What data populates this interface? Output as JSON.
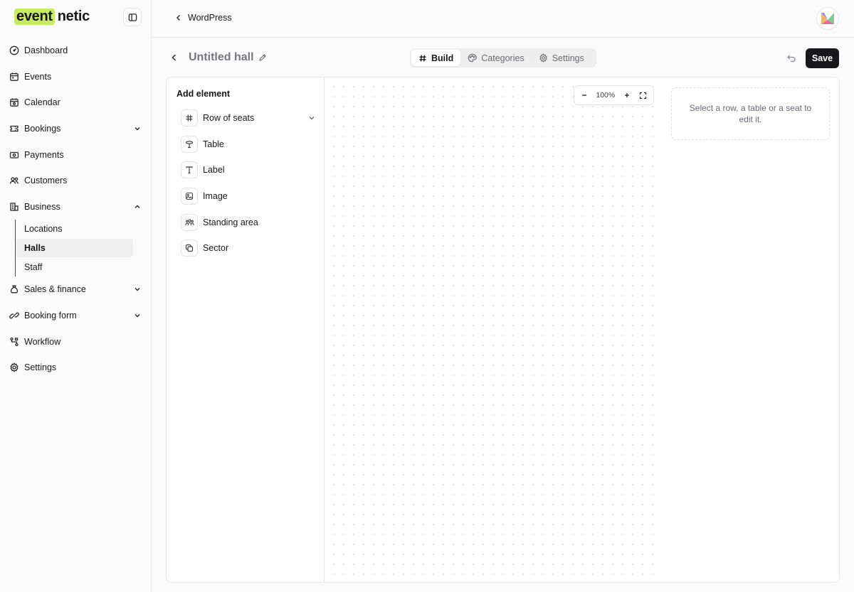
{
  "sidebar": {
    "logo": {
      "highlight": "event",
      "rest": "netic",
      "accent_color": "#c6ea60"
    },
    "collapse_icon": "sidebar-toggle-icon",
    "items": [
      {
        "label": "Dashboard",
        "icon": "gauge-icon"
      },
      {
        "label": "Events",
        "icon": "calendar-event-icon"
      },
      {
        "label": "Calendar",
        "icon": "calendar-icon"
      },
      {
        "label": "Bookings",
        "icon": "ticket-icon",
        "expandable": true,
        "expanded": false
      },
      {
        "label": "Payments",
        "icon": "cash-icon"
      },
      {
        "label": "Customers",
        "icon": "users-icon"
      },
      {
        "label": "Business",
        "icon": "building-icon",
        "expandable": true,
        "expanded": true,
        "children": [
          {
            "label": "Locations"
          },
          {
            "label": "Halls",
            "active": true
          },
          {
            "label": "Staff"
          }
        ]
      },
      {
        "label": "Sales & finance",
        "icon": "money-bag-icon",
        "expandable": true,
        "expanded": false
      },
      {
        "label": "Booking form",
        "icon": "form-icon",
        "expandable": true,
        "expanded": false
      },
      {
        "label": "Workflow",
        "icon": "workflow-icon"
      },
      {
        "label": "Settings",
        "icon": "gear-icon"
      }
    ]
  },
  "topbar": {
    "back_label": "WordPress"
  },
  "editor_header": {
    "title": "Untitled hall",
    "tabs": [
      {
        "label": "Build",
        "icon": "hash-icon",
        "active": true
      },
      {
        "label": "Categories",
        "icon": "palette-icon",
        "active": false
      },
      {
        "label": "Settings",
        "icon": "gear-icon",
        "active": false
      }
    ],
    "save_label": "Save"
  },
  "add_panel": {
    "title": "Add element",
    "elements": [
      {
        "label": "Row of seats",
        "icon": "hash-icon",
        "expandable": true
      },
      {
        "label": "Table",
        "icon": "table-icon"
      },
      {
        "label": "Label",
        "icon": "text-icon"
      },
      {
        "label": "Image",
        "icon": "image-icon"
      },
      {
        "label": "Standing area",
        "icon": "people-icon"
      },
      {
        "label": "Sector",
        "icon": "layers-icon"
      }
    ]
  },
  "canvas": {
    "zoom": "100%"
  },
  "properties": {
    "hint": "Select a row, a table or a seat to edit it."
  }
}
